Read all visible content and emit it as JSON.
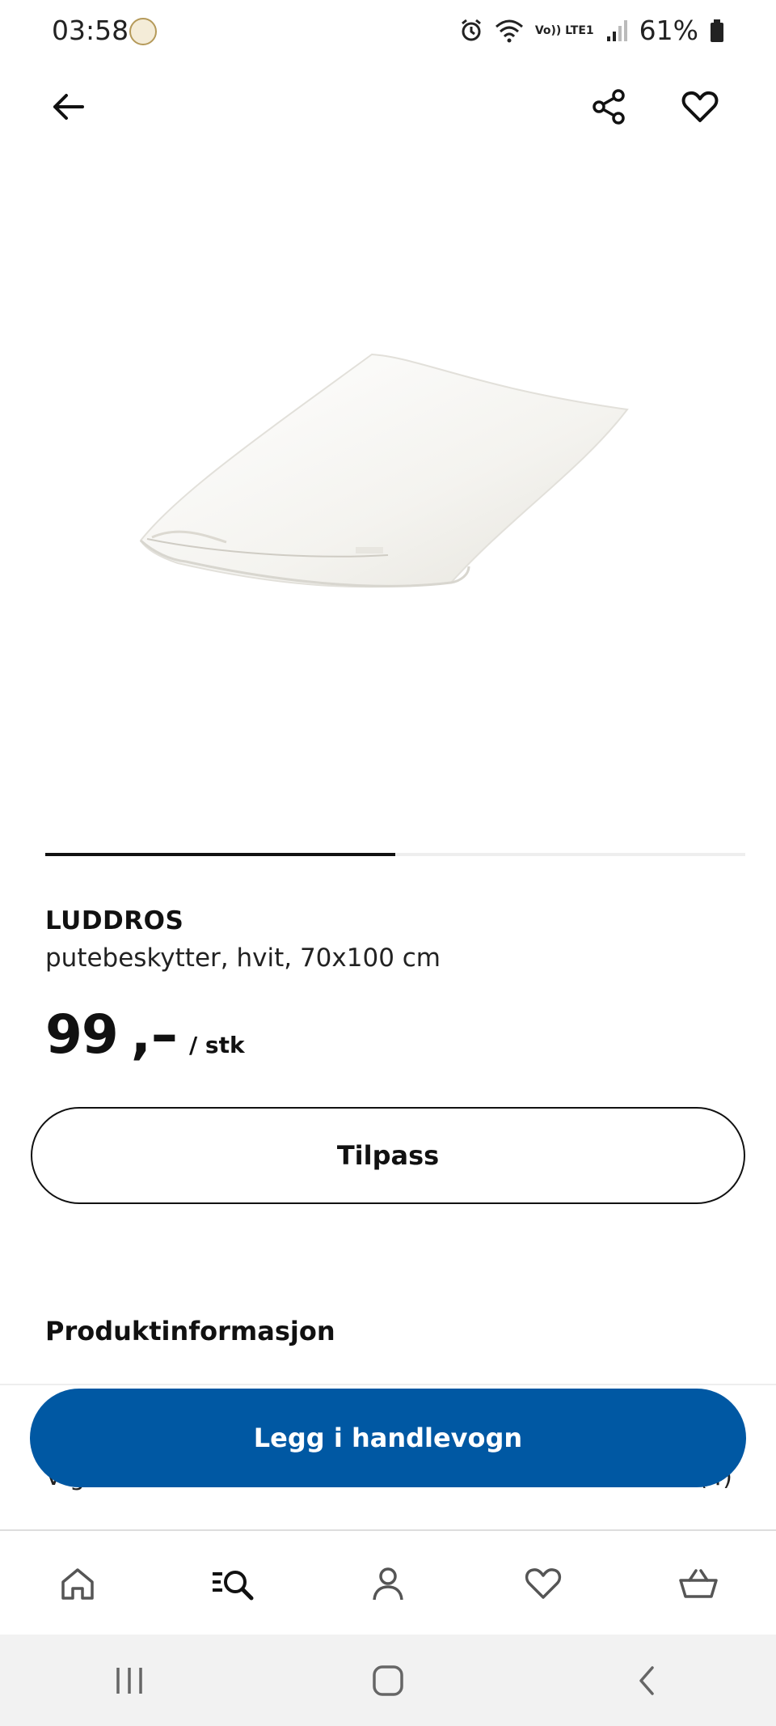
{
  "status_bar": {
    "time": "03:58",
    "battery": "61%",
    "network_label": "Vo)) LTE1",
    "icons": [
      "alarm-icon",
      "wifi-icon",
      "signal-icon",
      "battery-icon"
    ]
  },
  "top_bar": {
    "icons": [
      "back-arrow-icon",
      "share-icon",
      "heart-icon"
    ]
  },
  "gallery": {
    "progress": 0.5
  },
  "product": {
    "name": "LUDDROS",
    "description": "putebeskytter, hvit, 70x100 cm",
    "price_amount": "99",
    "price_suffix": ",–",
    "price_unit": "/ stk"
  },
  "buttons": {
    "customize": "Tilpass",
    "add_to_cart": "Legg i handlevogn"
  },
  "sections": {
    "product_info": "Produktinformasjon",
    "partial_left": "V g",
    "partial_right": "(4)"
  },
  "bottom_nav": {
    "items": [
      "home-icon",
      "search-icon",
      "profile-icon",
      "favorites-icon",
      "basket-icon"
    ]
  },
  "system_nav": {
    "items": [
      "recents-icon",
      "home-button-icon",
      "back-icon"
    ]
  },
  "colors": {
    "primary": "#0058a3",
    "text": "#111111",
    "divider": "#eeeeee"
  }
}
